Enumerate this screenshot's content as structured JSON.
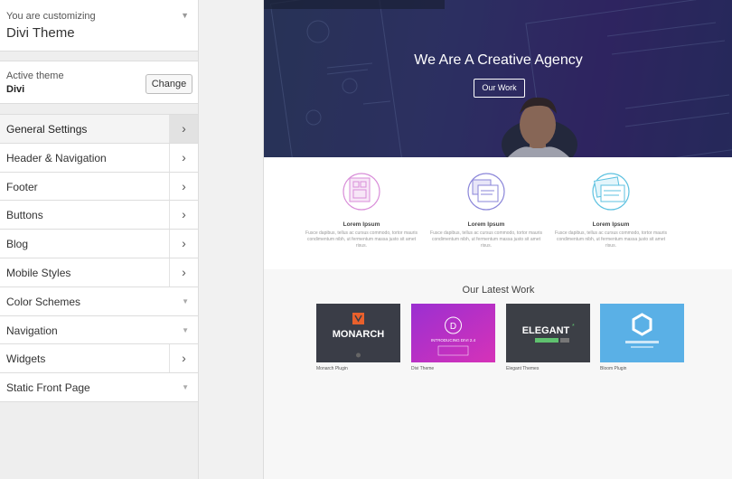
{
  "customizer": {
    "subtitle": "You are customizing",
    "title": "Divi Theme"
  },
  "active_theme": {
    "label": "Active theme",
    "name": "Divi",
    "change_label": "Change"
  },
  "sections": [
    {
      "label": "General Settings",
      "indicator": "chevron"
    },
    {
      "label": "Header & Navigation",
      "indicator": "chevron"
    },
    {
      "label": "Footer",
      "indicator": "chevron"
    },
    {
      "label": "Buttons",
      "indicator": "chevron"
    },
    {
      "label": "Blog",
      "indicator": "chevron"
    },
    {
      "label": "Mobile Styles",
      "indicator": "chevron"
    },
    {
      "label": "Color Schemes",
      "indicator": "caret"
    },
    {
      "label": "Navigation",
      "indicator": "caret"
    },
    {
      "label": "Widgets",
      "indicator": "chevron"
    },
    {
      "label": "Static Front Page",
      "indicator": "caret"
    }
  ],
  "icons": {
    "chevron": "›",
    "caret": "▼"
  },
  "preview": {
    "hero_title": "We Are A Creative Agency",
    "hero_button": "Our Work",
    "features": [
      {
        "title": "Lorem Ipsum",
        "text": "Fusce dapibus, tellus ac cursus commodo, tortor mauris condimentum nibh, ut fermentum massa justo sit amet risus.",
        "color": "#d98ed9"
      },
      {
        "title": "Lorem Ipsum",
        "text": "Fusce dapibus, tellus ac cursus commodo, tortor mauris condimentum nibh, ut fermentum massa justo sit amet risus.",
        "color": "#8a85d9"
      },
      {
        "title": "Lorem Ipsum",
        "text": "Fusce dapibus, tellus ac cursus commodo, tortor mauris condimentum nibh, ut fermentum massa justo sit amet risus.",
        "color": "#5cc1e0"
      }
    ],
    "work_title": "Our Latest Work",
    "portfolio": [
      {
        "caption": "Monarch Plugin",
        "logo": "MONARCH",
        "bg": "#3a3d47"
      },
      {
        "caption": "Divi Theme",
        "logo": "INTRODUCING DIVI 2.4",
        "bg": "#b531c9"
      },
      {
        "caption": "Elegant Themes",
        "logo": "ELEGANT",
        "bg": "#3c3f46"
      },
      {
        "caption": "Bloom Plugin",
        "logo": "",
        "bg": "#56a8e0"
      }
    ]
  },
  "colors": {
    "sidebar_bg": "#eeeeee",
    "hero_purple": "#3d2a7a",
    "accent_orange": "#e8602c"
  }
}
